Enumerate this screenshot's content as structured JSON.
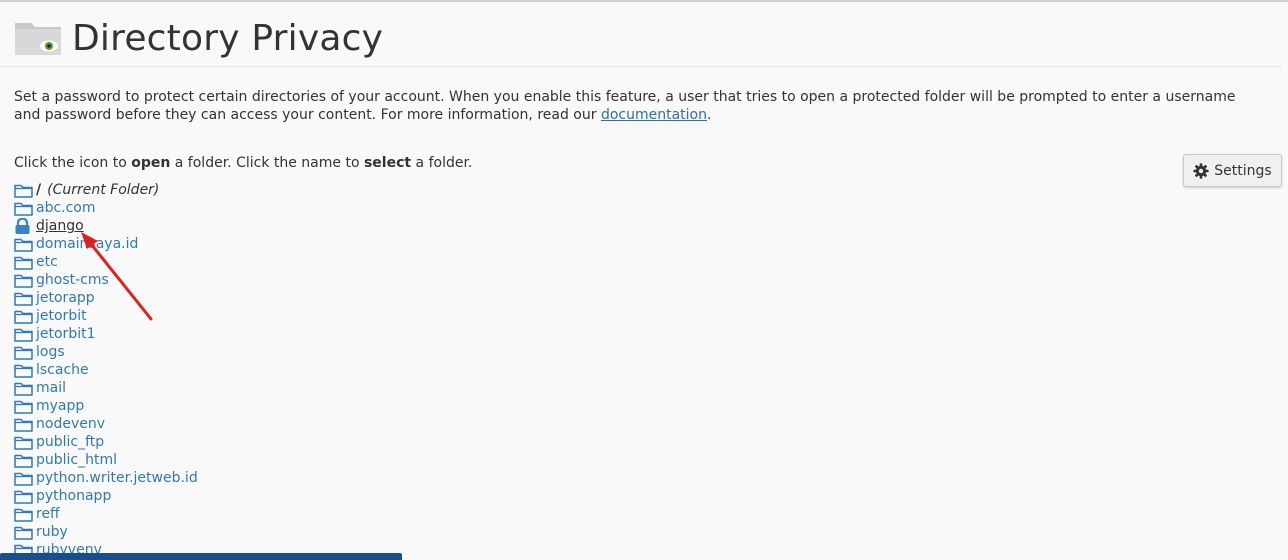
{
  "page": {
    "title": "Directory Privacy",
    "description_before_link": "Set a password to protect certain directories of your account. When you enable this feature, a user that tries to open a protected folder will be prompted to enter a username and password before they can access your content. For more information, read our ",
    "description_link": "documentation",
    "description_after_link": ".",
    "instruction_part1": "Click the icon to ",
    "instruction_bold1": "open",
    "instruction_part2": " a folder. Click the name to ",
    "instruction_bold2": "select",
    "instruction_part3": " a folder."
  },
  "settings": {
    "label": "Settings",
    "icon": "gear-icon"
  },
  "current_folder": {
    "slash": "/",
    "label": "(Current Folder)"
  },
  "folders": [
    {
      "name": "abc.com",
      "locked": false
    },
    {
      "name": "django",
      "locked": true
    },
    {
      "name": "domainsaya.id",
      "locked": false
    },
    {
      "name": "etc",
      "locked": false
    },
    {
      "name": "ghost-cms",
      "locked": false
    },
    {
      "name": "jetorapp",
      "locked": false
    },
    {
      "name": "jetorbit",
      "locked": false
    },
    {
      "name": "jetorbit1",
      "locked": false
    },
    {
      "name": "logs",
      "locked": false
    },
    {
      "name": "lscache",
      "locked": false
    },
    {
      "name": "mail",
      "locked": false
    },
    {
      "name": "myapp",
      "locked": false
    },
    {
      "name": "nodevenv",
      "locked": false
    },
    {
      "name": "public_ftp",
      "locked": false
    },
    {
      "name": "public_html",
      "locked": false
    },
    {
      "name": "python.writer.jetweb.id",
      "locked": false
    },
    {
      "name": "pythonapp",
      "locked": false
    },
    {
      "name": "reff",
      "locked": false
    },
    {
      "name": "ruby",
      "locked": false
    },
    {
      "name": "rubyvenv",
      "locked": false
    }
  ],
  "colors": {
    "link": "#2f7ab6",
    "folder_icon": "#2f7ab6",
    "lock_icon": "#3b82c4",
    "annotation_arrow": "#e02020",
    "bottom_bar": "#1b4d8c"
  }
}
